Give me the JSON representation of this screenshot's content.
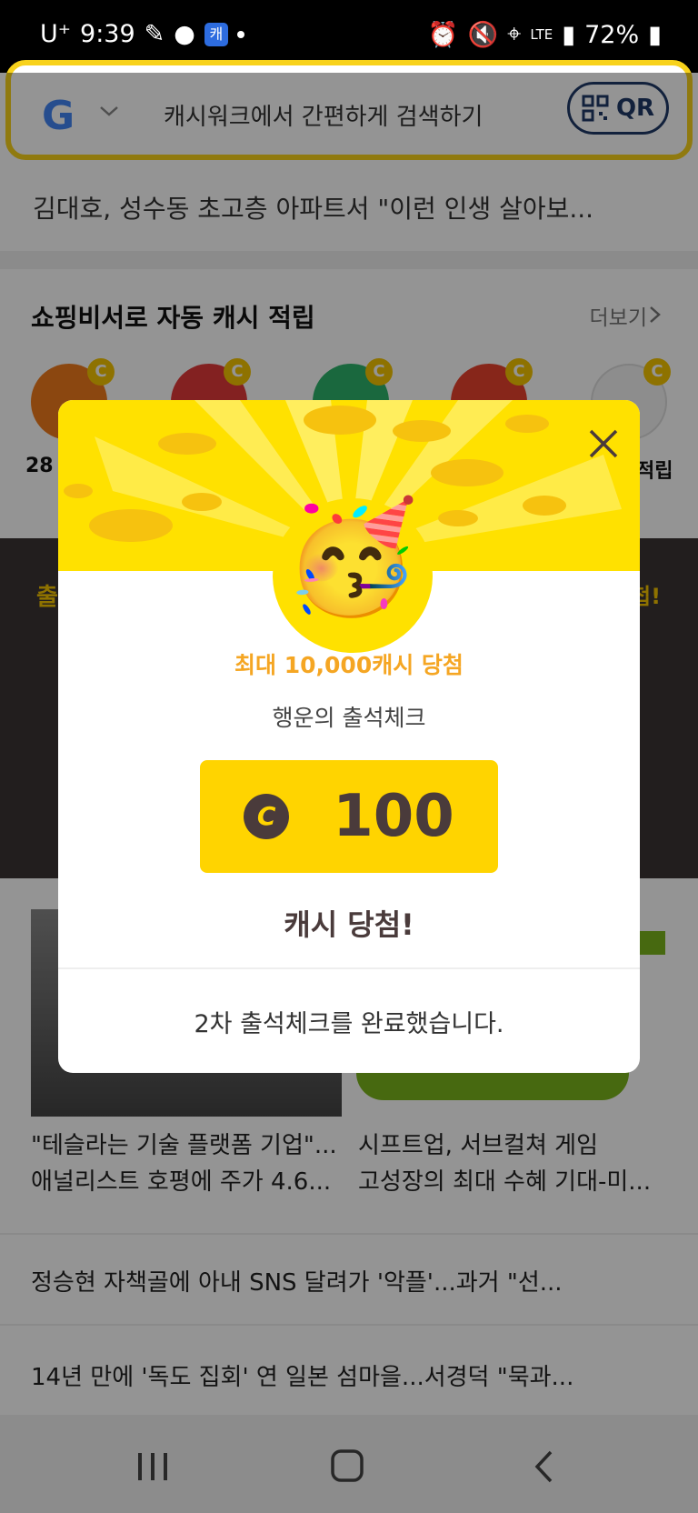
{
  "status_bar": {
    "carrier": "U⁺",
    "time": "9:39",
    "app_chip": "캐",
    "network": "LTE",
    "battery": "72%"
  },
  "search": {
    "placeholder": "캐시워크에서 간편하게 검색하기",
    "qr_label": "QR"
  },
  "feed": {
    "top_news": "김대호, 성수동 초고층 아파트서 \"이런 인생 살아보...",
    "section_title": "쇼핑비서로 자동 캐시 적립",
    "more_label": "더보기",
    "shop_left_text": "28",
    "shop_right_text": "적립",
    "dark_left_text": "출",
    "dark_right_text": "첩!",
    "news_cards": [
      {
        "caption_line1": "\"테슬라는 기술 플랫폼 기업\"...",
        "caption_line2": "애널리스트 호평에 주가 4.6..."
      },
      {
        "caption_line1": "시프트업, 서브컬쳐 게임",
        "caption_line2": "고성장의 최대 수혜 기대-미..."
      }
    ],
    "news_list": [
      "정승현 자책골에 아내 SNS 달려가 '악플'...과거 \"선...",
      "14년 만에 '독도 집회' 연 일본 섬마을...서경덕 \"묵과..."
    ]
  },
  "modal": {
    "prize_max": "최대 10,000캐시 당첨",
    "subtitle": "행운의 출석체크",
    "coin_symbol": "C",
    "amount": "100",
    "win_label": "캐시 당첨!",
    "completion_message": "2차 출석체크를 완료했습니다.",
    "icons": [
      "close-icon",
      "party-face-icon",
      "coin-icon"
    ]
  },
  "colors": {
    "accent_yellow": "#ffd400",
    "header_yellow": "#ffe100",
    "prize_orange": "#f5a623",
    "text_brown": "#4a3b3b"
  }
}
